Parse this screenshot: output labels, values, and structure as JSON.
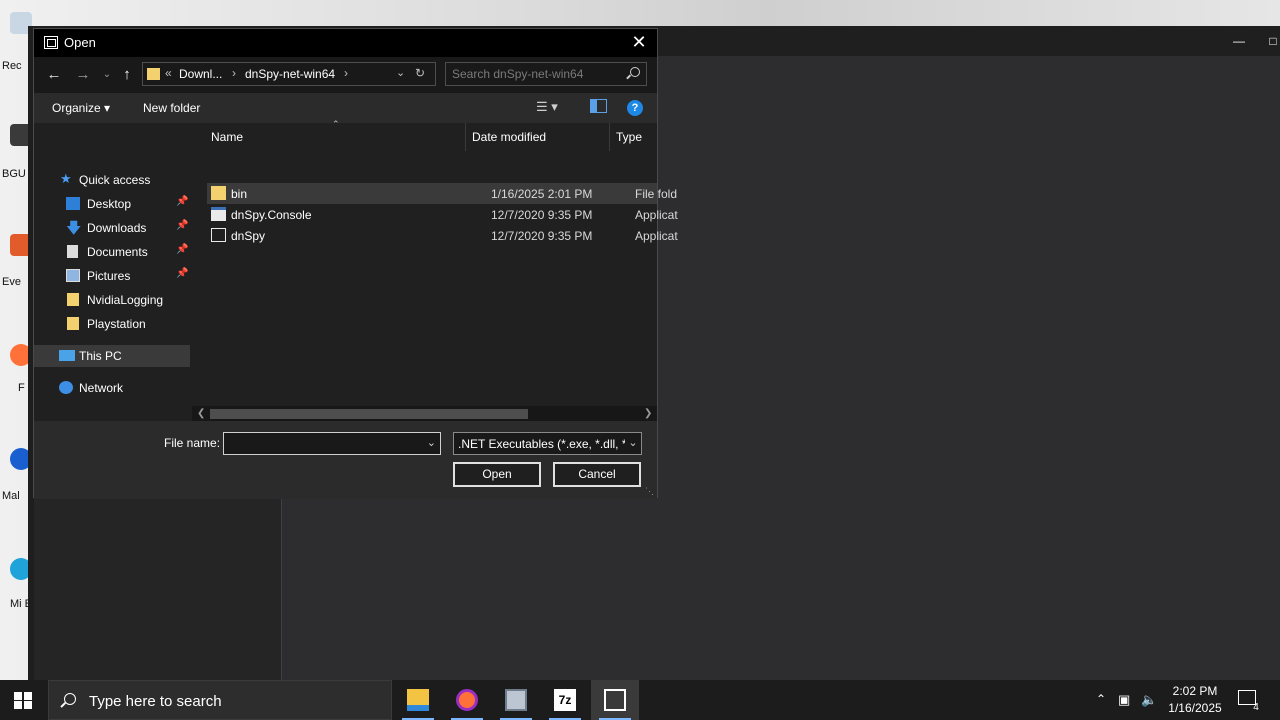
{
  "desktop": {
    "icons": [
      {
        "label": "Rec",
        "icon": "recycle-bin-icon"
      },
      {
        "label": "BGU",
        "icon": "app-shortcut-icon"
      },
      {
        "label": "Eve",
        "icon": "app-shortcut-icon"
      },
      {
        "label": "F",
        "icon": "firefox-shortcut-icon"
      },
      {
        "label": "Mal",
        "icon": "app-shortcut-icon"
      },
      {
        "label": "Mi E",
        "icon": "edge-shortcut-icon"
      }
    ]
  },
  "dialog": {
    "title": "Open",
    "address": {
      "overflow": "«",
      "crumbs": [
        "Downl...",
        "dnSpy-net-win64"
      ]
    },
    "search_placeholder": "Search dnSpy-net-win64",
    "toolbar": {
      "organize": "Organize ▾",
      "new_folder": "New folder",
      "help": "?"
    },
    "nav": {
      "quick_access": "Quick access",
      "pinned": [
        {
          "label": "Desktop",
          "icon": "desktop-folder-icon",
          "pinned": true
        },
        {
          "label": "Downloads",
          "icon": "downloads-folder-icon",
          "pinned": true
        },
        {
          "label": "Documents",
          "icon": "documents-folder-icon",
          "pinned": true
        },
        {
          "label": "Pictures",
          "icon": "pictures-folder-icon",
          "pinned": true
        },
        {
          "label": "NvidiaLogging",
          "icon": "folder-icon",
          "pinned": false
        },
        {
          "label": "Playstation",
          "icon": "folder-icon",
          "pinned": false
        }
      ],
      "this_pc": "This PC",
      "network": "Network"
    },
    "columns": {
      "name": "Name",
      "date_modified": "Date modified",
      "type": "Type"
    },
    "files": [
      {
        "name": "bin",
        "date": "1/16/2025 2:01 PM",
        "type": "File fold",
        "icon": "folder-icon",
        "selected": true
      },
      {
        "name": "dnSpy.Console",
        "date": "12/7/2020 9:35 PM",
        "type": "Applicat",
        "icon": "console-app-icon",
        "selected": false
      },
      {
        "name": "dnSpy",
        "date": "12/7/2020 9:35 PM",
        "type": "Applicat",
        "icon": "dnspy-app-icon",
        "selected": false
      }
    ],
    "file_name_label": "File name:",
    "file_name_value": "",
    "filter": ".NET Executables (*.exe, *.dll, *.",
    "open_button": "Open",
    "cancel_button": "Cancel"
  },
  "taskbar": {
    "search_placeholder": "Type here to search",
    "apps": [
      "file-explorer-icon",
      "firefox-icon",
      "computer-app-icon",
      "7zip-icon",
      "dnspy-taskbar-icon"
    ],
    "clock_time": "2:02 PM",
    "clock_date": "1/16/2025",
    "notification_count": "4"
  }
}
